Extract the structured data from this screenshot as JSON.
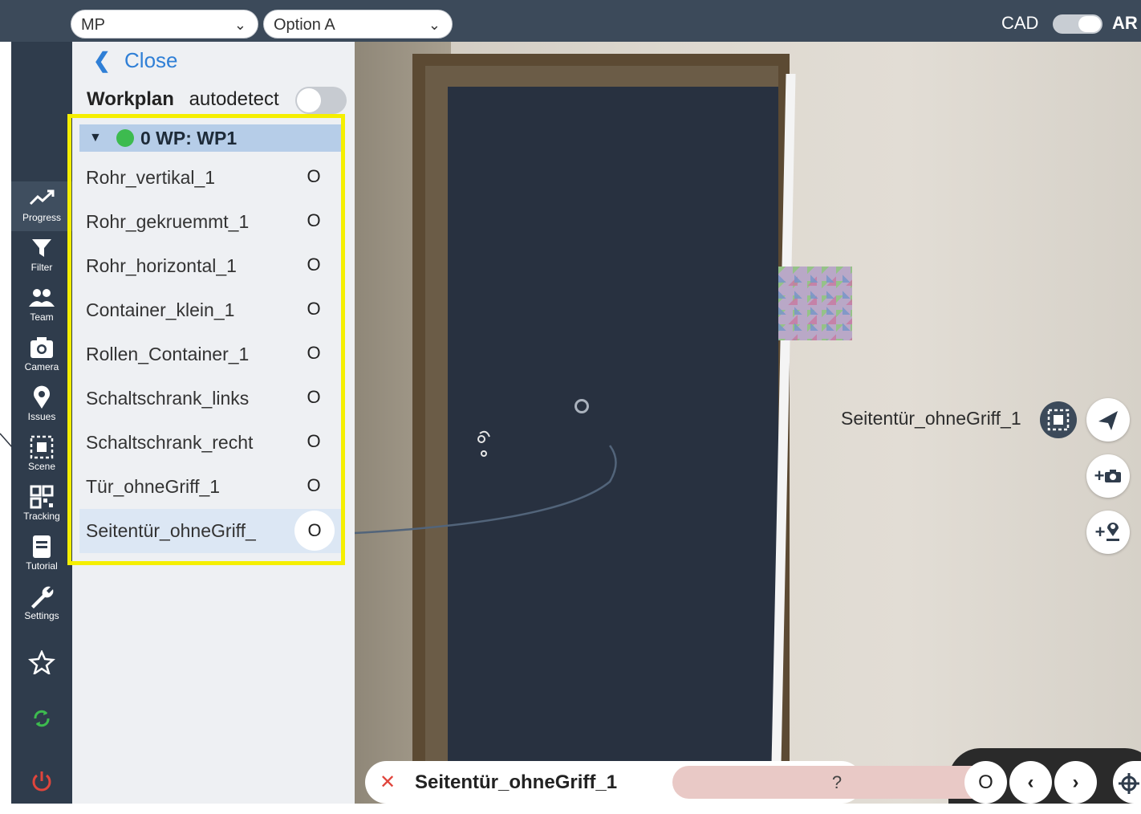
{
  "topbar": {
    "select1": "MP",
    "select2": "Option A",
    "cad_label": "CAD",
    "ar_label": "AR"
  },
  "sidebar": {
    "items": [
      {
        "label": "Progress",
        "icon": "progress-icon"
      },
      {
        "label": "Filter",
        "icon": "filter-icon"
      },
      {
        "label": "Team",
        "icon": "team-icon"
      },
      {
        "label": "Camera",
        "icon": "camera-icon"
      },
      {
        "label": "Issues",
        "icon": "pin-icon"
      },
      {
        "label": "Scene",
        "icon": "scene-icon"
      },
      {
        "label": "Tracking",
        "icon": "qr-icon"
      },
      {
        "label": "Tutorial",
        "icon": "book-icon"
      },
      {
        "label": "Settings",
        "icon": "wrench-icon"
      }
    ]
  },
  "panel": {
    "close_label": "Close",
    "workplan_label": "Workplan",
    "autodetect_label": "autodetect",
    "wp_header": "0 WP: WP1",
    "rows": [
      "Rohr_vertikal_1",
      "Rohr_gekruemmt_1",
      "Rohr_horizontal_1",
      "Container_klein_1",
      "Rollen_Container_1",
      "Schaltschrank_links",
      "Schaltschrank_recht",
      "Tür_ohneGriff_1",
      "Seitentür_ohneGriff_"
    ],
    "row_status": "O"
  },
  "ar": {
    "object_label": "Seitentür_ohneGriff_1",
    "add_photo": "+",
    "add_pin": "+"
  },
  "bottom": {
    "close": "✕",
    "title": "Seitentür_ohneGriff_1",
    "status": "?",
    "circle": "O",
    "prev": "‹",
    "next": "›"
  },
  "colors": {
    "highlight_border": "#f5ef00",
    "accent_blue": "#2f7fd6",
    "status_dot": "#3dbb4f",
    "sidebar_bg": "#2f3c4c"
  }
}
